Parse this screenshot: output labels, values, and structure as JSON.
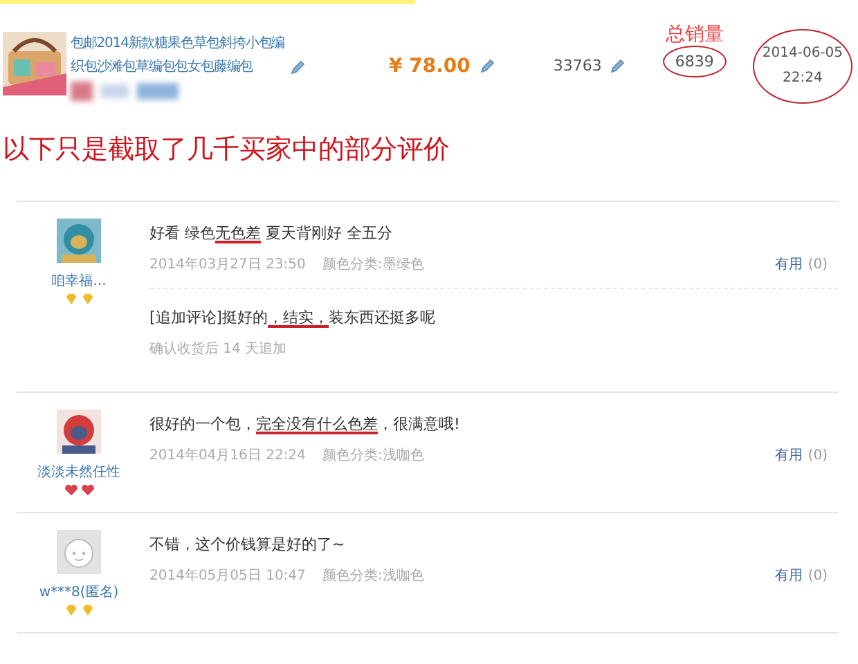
{
  "product": {
    "title": "包邮2014新款糖果色草包斜挎小包编织包沙滩包草编包包女包藤编包",
    "price": "¥ 78.00",
    "stock": "33763",
    "sales_label": "总销量",
    "sales": {
      "text": "6839",
      "circled": true
    },
    "date": {
      "day": "2014-06-05",
      "time": "22:24",
      "circled": true
    }
  },
  "heading": "以下只是截取了几千买家中的部分评价",
  "reviews": [
    {
      "user": "咱幸福...",
      "avatar": {
        "kind": "picture"
      },
      "badges": [
        {
          "kind": "diamond"
        },
        {
          "kind": "diamond"
        }
      ],
      "comment": [
        {
          "text": "好看 绿色",
          "underlined": false
        },
        {
          "text": "无色差",
          "underlined": true
        },
        {
          "text": " 夏天背刚好 全五分",
          "underlined": false
        }
      ],
      "date": "2014年03月27日 23:50",
      "variant": "颜色分类:墨绿色",
      "useful_label": "有用",
      "useful_count": "(0)",
      "followup": {
        "comment": [
          {
            "text": "[追加评论]挺好的",
            "underlined": false
          },
          {
            "text": "，结实，",
            "underlined": true
          },
          {
            "text": "装东西还挺多呢",
            "underlined": false
          }
        ],
        "note": "确认收货后 14 天追加"
      }
    },
    {
      "user": "淡淡未然任性",
      "avatar": {
        "kind": "picture"
      },
      "badges": [
        {
          "kind": "heart"
        },
        {
          "kind": "heart"
        }
      ],
      "comment": [
        {
          "text": "很好的一个包，",
          "underlined": false
        },
        {
          "text": "完全没有什么色差",
          "underlined": true
        },
        {
          "text": "，很满意哦!",
          "underlined": false
        }
      ],
      "date": "2014年04月16日 22:24",
      "variant": "颜色分类:浅咖色",
      "useful_label": "有用",
      "useful_count": "(0)"
    },
    {
      "user": "w***8(匿名)",
      "avatar": {
        "kind": "default"
      },
      "badges": [
        {
          "kind": "diamond"
        },
        {
          "kind": "diamond"
        }
      ],
      "comment": [
        {
          "text": "不错，这个价钱算是好的了~",
          "underlined": false
        }
      ],
      "date": "2014年05月05日 10:47",
      "variant": "颜色分类:浅咖色",
      "useful_label": "有用",
      "useful_count": "(0)"
    }
  ]
}
